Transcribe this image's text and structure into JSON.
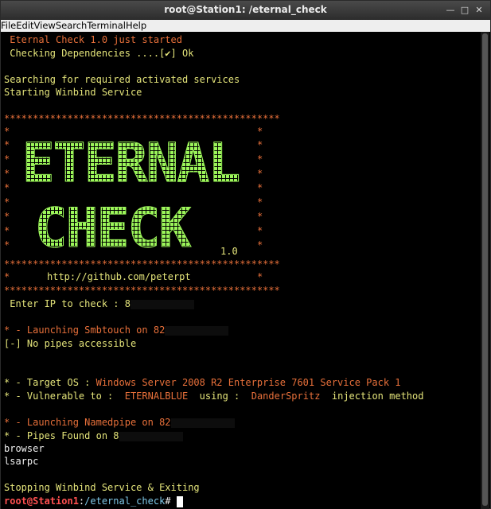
{
  "window": {
    "title": "root@Station1: /eternal_check"
  },
  "menu": [
    "File",
    "Edit",
    "View",
    "Search",
    "Terminal",
    "Help"
  ],
  "terminal": {
    "l1": " Eternal Check 1.0 just started",
    "l2": " Checking Dependencies ....[✔] Ok",
    "l3": "Searching for required activated services",
    "l4": "Starting Winbind Service",
    "stars": "************************************************",
    "art_word1": "ETERNAL",
    "art_word2": "CHECK",
    "version": "1.0",
    "url": "http://github.com/peterpt",
    "ip_prompt": " Enter IP to check : 8",
    "smb_line": "* - Launching Smbtouch on 82",
    "no_pipes": "[-] No pipes accessible",
    "target_label": "* - Target OS : ",
    "target_value": "Windows Server 2008 R2 Enterprise 7601 Service Pack 1",
    "vuln_prefix": "* - Vulnerable to : ",
    "vuln_name": "ETERNALBLUE",
    "using": " using : ",
    "tool": "DanderSpritz",
    "method": " injection method",
    "named_line": "* - Launching Namedpipe on 82",
    "pipes_found": "* - Pipes Found on 8",
    "pipe1": "browser",
    "pipe2": "lsarpc",
    "stopping": "Stopping Winbind Service & Exiting",
    "prompt_user": "root@Station1",
    "prompt_sep": ":",
    "prompt_path": "/eternal_check",
    "prompt_hash": "# "
  },
  "colors": {
    "orange": "#e8703a",
    "green": "#9cf55a",
    "yellow": "#e4e47a",
    "red": "#ff5050"
  }
}
